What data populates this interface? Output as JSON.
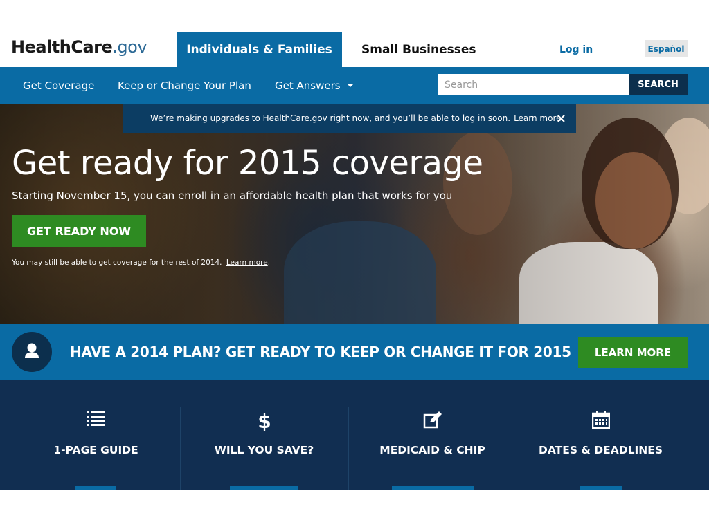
{
  "header": {
    "logo": {
      "strong": "HealthCare",
      "rest": ".gov"
    },
    "tabs": [
      {
        "label": "Individuals & Families",
        "active": true
      },
      {
        "label": "Small Businesses",
        "active": false
      }
    ],
    "login_label": "Log in",
    "language_label": "Español"
  },
  "nav": {
    "items": [
      {
        "label": "Get Coverage"
      },
      {
        "label": "Keep or Change Your Plan"
      },
      {
        "label": "Get Answers",
        "has_dropdown": true
      }
    ],
    "search": {
      "placeholder": "Search",
      "button_label": "SEARCH"
    }
  },
  "notice": {
    "text": "We’re making upgrades to HealthCare.gov right now, and you’ll be able to log in soon.",
    "link": "Learn more",
    "suffix": ".",
    "close": "×"
  },
  "hero": {
    "title": "Get ready for 2015 coverage",
    "subtitle": "Starting November 15, you can enroll in an affordable health plan that works for you",
    "cta_label": "GET READY NOW",
    "note": "You may still be able to get coverage for the rest of 2014.",
    "note_link": "Learn more",
    "note_suffix": "."
  },
  "banner": {
    "icon": "person-icon",
    "text": "HAVE A 2014 PLAN? GET READY TO KEEP OR CHANGE IT FOR 2015",
    "button_label": "LEARN MORE"
  },
  "tiles": [
    {
      "label": "1-PAGE GUIDE",
      "icon": "list-icon"
    },
    {
      "label": "WILL YOU SAVE?",
      "icon": "dollar-icon"
    },
    {
      "label": "MEDICAID & CHIP",
      "icon": "edit-icon"
    },
    {
      "label": "DATES & DEADLINES",
      "icon": "calendar-icon"
    }
  ],
  "colors": {
    "primary_blue": "#0a6ba4",
    "dark_navy": "#112e51",
    "notice_bg": "#0c3d63",
    "cta_green": "#2e8b22"
  }
}
